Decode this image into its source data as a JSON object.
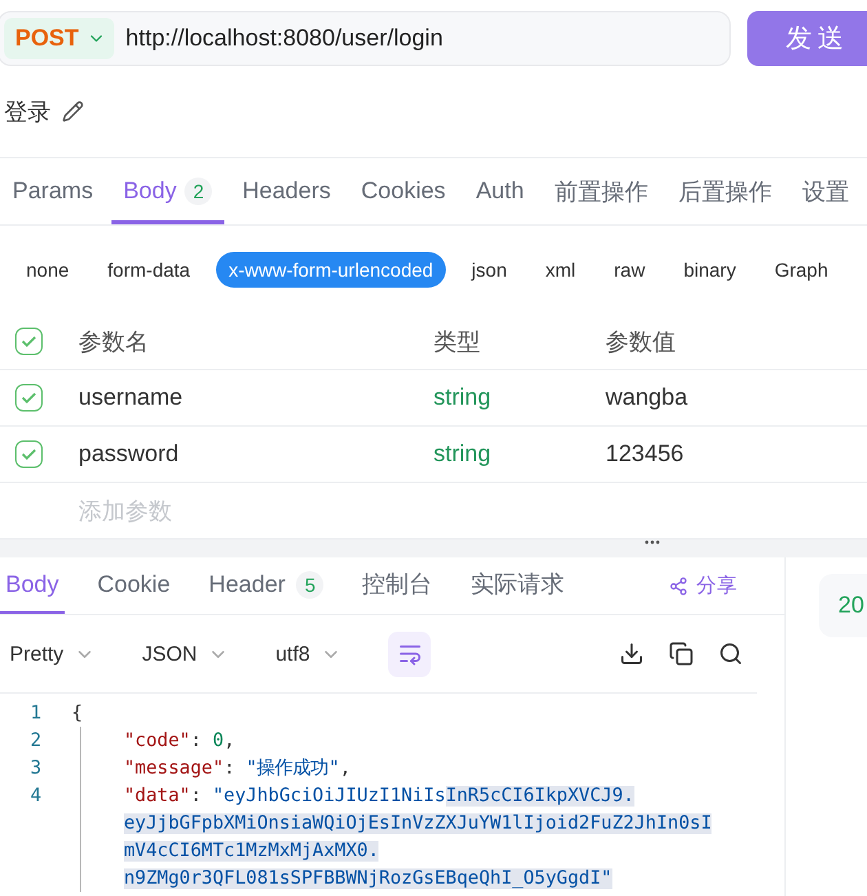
{
  "request": {
    "method": "POST",
    "url": "http://localhost:8080/user/login",
    "send_label": "发送"
  },
  "title": "登录",
  "request_tabs": [
    {
      "label": "Params",
      "selected": false
    },
    {
      "label": "Body",
      "badge": "2",
      "selected": true
    },
    {
      "label": "Headers",
      "selected": false
    },
    {
      "label": "Cookies",
      "selected": false
    },
    {
      "label": "Auth",
      "selected": false
    },
    {
      "label": "前置操作",
      "selected": false
    },
    {
      "label": "后置操作",
      "selected": false
    },
    {
      "label": "设置",
      "selected": false
    }
  ],
  "body_types": [
    {
      "label": "none",
      "selected": false
    },
    {
      "label": "form-data",
      "selected": false
    },
    {
      "label": "x-www-form-urlencoded",
      "selected": true
    },
    {
      "label": "json",
      "selected": false
    },
    {
      "label": "xml",
      "selected": false
    },
    {
      "label": "raw",
      "selected": false
    },
    {
      "label": "binary",
      "selected": false
    },
    {
      "label": "Graph",
      "selected": false
    }
  ],
  "params": {
    "header_checked": true,
    "columns": [
      "参数名",
      "类型",
      "参数值"
    ],
    "rows": [
      {
        "name": "username",
        "type": "string",
        "value": "wangba",
        "checked": true
      },
      {
        "name": "password",
        "type": "string",
        "value": "123456",
        "checked": true
      }
    ],
    "add_placeholder": "添加参数"
  },
  "response": {
    "tabs": [
      {
        "label": "Body",
        "selected": true
      },
      {
        "label": "Cookie",
        "selected": false
      },
      {
        "label": "Header",
        "badge": "5",
        "selected": false
      },
      {
        "label": "控制台",
        "selected": false
      },
      {
        "label": "实际请求",
        "selected": false
      }
    ],
    "share_label": "分享",
    "formats": [
      "Pretty",
      "JSON",
      "utf8"
    ],
    "wrap_on": true,
    "code_lines": [
      {
        "number": "1",
        "tokens": [
          {
            "kind": "punct",
            "text": "{"
          }
        ]
      },
      {
        "number": "2",
        "tokens": [
          {
            "kind": "key",
            "text": "\"code\""
          },
          {
            "kind": "punct",
            "text": ": "
          },
          {
            "kind": "number",
            "text": "0"
          },
          {
            "kind": "punct",
            "text": ","
          }
        ]
      },
      {
        "number": "3",
        "tokens": [
          {
            "kind": "key",
            "text": "\"message\""
          },
          {
            "kind": "punct",
            "text": ": "
          },
          {
            "kind": "string",
            "text": "\"操作成功\""
          },
          {
            "kind": "punct",
            "text": ","
          }
        ]
      },
      {
        "number": "4",
        "tokens": [
          {
            "kind": "key",
            "text": "\"data\""
          },
          {
            "kind": "punct",
            "text": ": "
          },
          {
            "kind": "string",
            "text": "\"eyJhbGciOiJIUzI1NiIs"
          },
          {
            "kind": "string",
            "text": "InR5cCI6IkpXVCJ9.",
            "highlighted": true
          }
        ]
      },
      {
        "tokens": [
          {
            "kind": "string",
            "text": "eyJjbGFpbXMiOnsiaWQiOjEsInVzZXJuYW1lIjoid2FuZ2JhIn0sI",
            "highlighted": true
          }
        ]
      },
      {
        "tokens": [
          {
            "kind": "string",
            "text": "mV4cCI6MTc1MzMxMjAxMX0.",
            "highlighted": true
          }
        ]
      },
      {
        "tokens": [
          {
            "kind": "string",
            "text": "n9ZMg0r3QFL081sSPFBBWNjRozGsEBqeQhI_O5yGgdI\"",
            "highlighted": true
          }
        ]
      }
    ]
  },
  "status": {
    "code": "20"
  }
}
